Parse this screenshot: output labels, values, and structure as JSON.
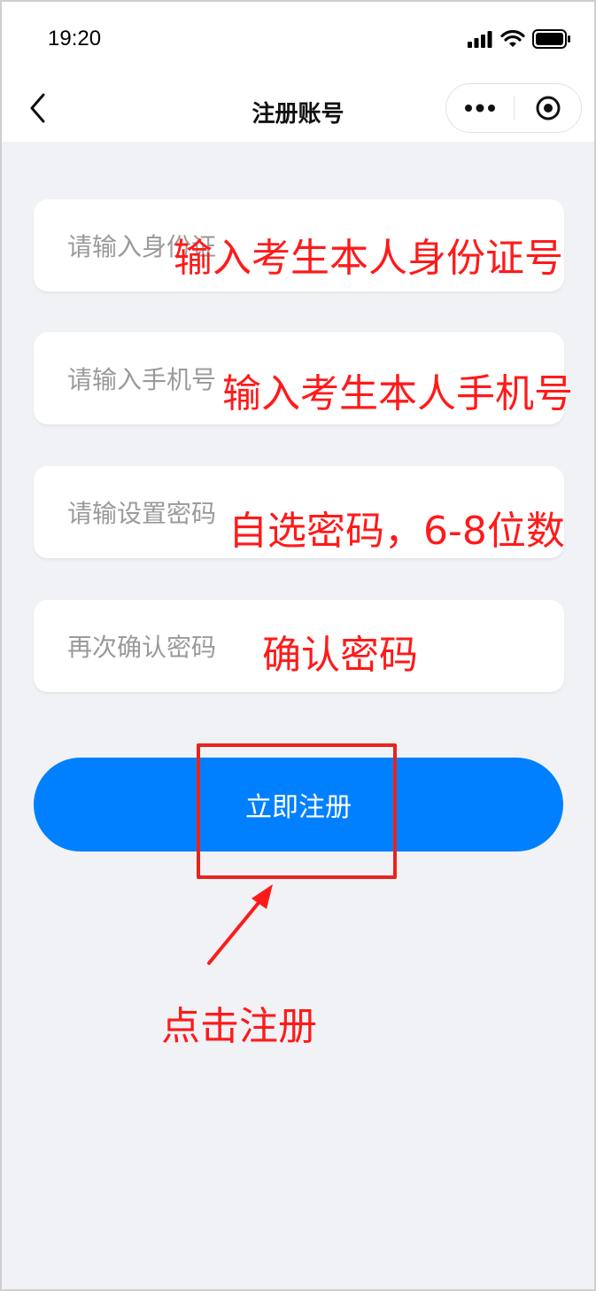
{
  "status_bar": {
    "time": "19:20",
    "icons": [
      "signal-icon",
      "wifi-icon",
      "battery-icon"
    ]
  },
  "nav": {
    "title": "注册账号",
    "back_icon": "chevron-left-icon",
    "capsule_icons": [
      "more-icon",
      "target-icon"
    ]
  },
  "form": {
    "id_placeholder": "请输入身份证",
    "phone_placeholder": "请输入手机号",
    "password_placeholder": "请输设置密码",
    "confirm_placeholder": "再次确认密码",
    "submit_label": "立即注册"
  },
  "annotations": {
    "id_note": "输入考生本人身份证号",
    "phone_note": "输入考生本人手机号",
    "password_note": "自选密码，6-8位数",
    "confirm_note": "确认密码",
    "click_note": "点击注册"
  },
  "colors": {
    "accent": "#0080ff",
    "annotation_red": "#ff1a1a",
    "background": "#f0f2f6"
  }
}
